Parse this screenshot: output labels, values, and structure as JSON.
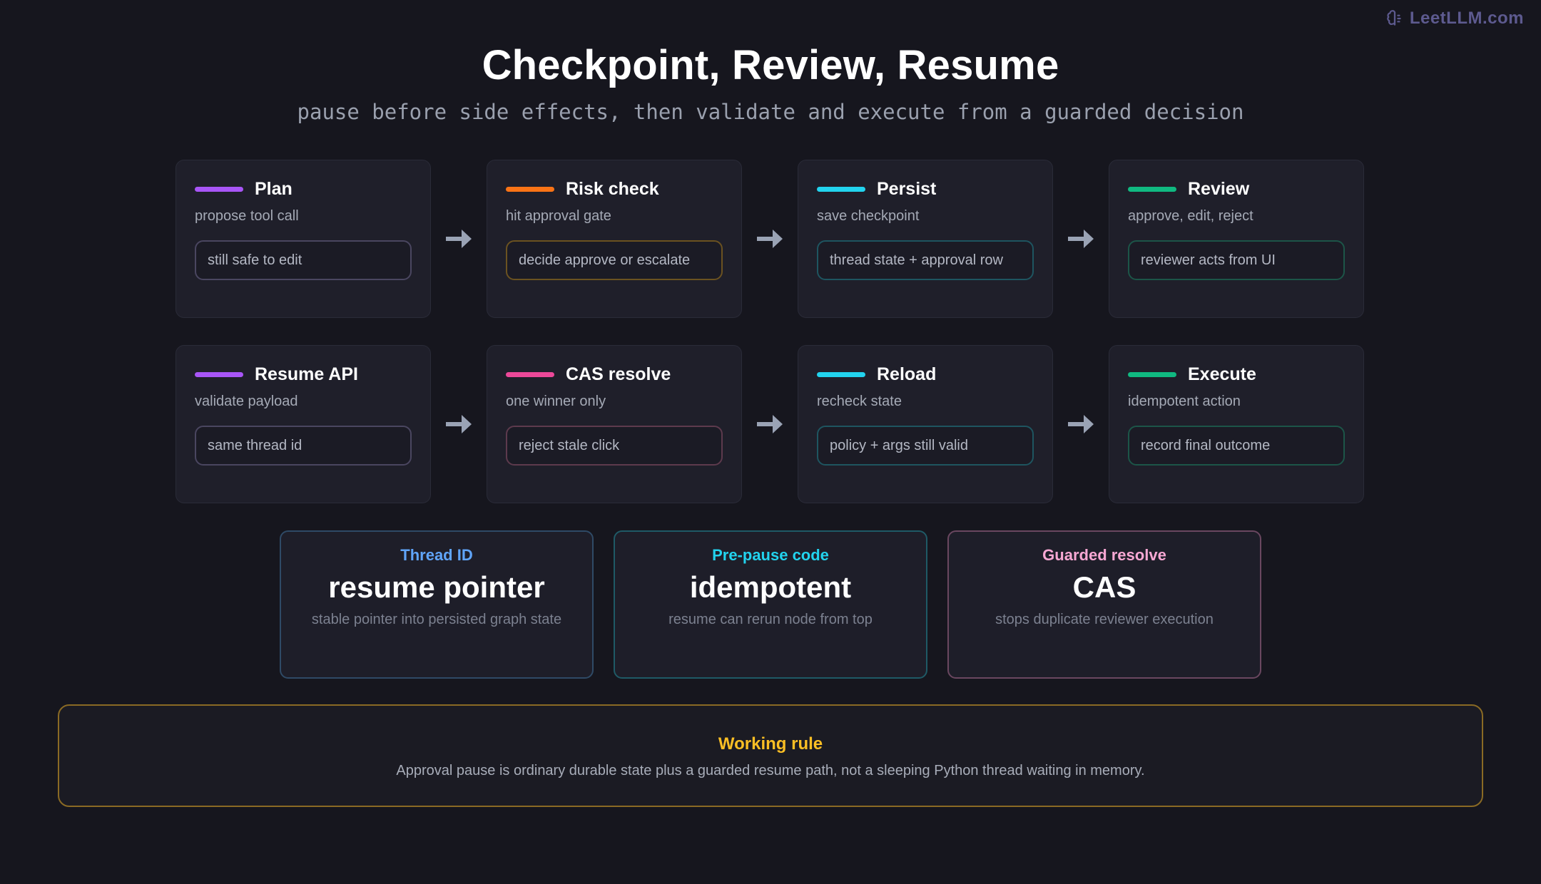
{
  "brand": {
    "icon": "brain-icon",
    "text": "LeetLLM.com",
    "color": "#5d5a8f"
  },
  "header": {
    "title": "Checkpoint, Review, Resume",
    "subtitle": "pause before side effects, then validate and execute from a guarded decision"
  },
  "rows": [
    {
      "cards": [
        {
          "title": "Plan",
          "subtitle": "propose tool call",
          "chip": "still safe to edit",
          "accent": "#a855f7",
          "chip_border": "#4a4660"
        },
        {
          "title": "Risk check",
          "subtitle": "hit approval gate",
          "chip": "decide approve or escalate",
          "accent": "#f97316",
          "chip_border": "#6b5220"
        },
        {
          "title": "Persist",
          "subtitle": "save checkpoint",
          "chip": "thread state + approval row",
          "accent": "#22d3ee",
          "chip_border": "#1e5560"
        },
        {
          "title": "Review",
          "subtitle": "approve, edit, reject",
          "chip": "reviewer acts from UI",
          "accent": "#10b981",
          "chip_border": "#1c5548"
        }
      ]
    },
    {
      "cards": [
        {
          "title": "Resume API",
          "subtitle": "validate payload",
          "chip": "same thread id",
          "accent": "#a855f7",
          "chip_border": "#4a4660"
        },
        {
          "title": "CAS resolve",
          "subtitle": "one winner only",
          "chip": "reject stale click",
          "accent": "#ec4899",
          "chip_border": "#5d3a4d"
        },
        {
          "title": "Reload",
          "subtitle": "recheck state",
          "chip": "policy + args still valid",
          "accent": "#22d3ee",
          "chip_border": "#1e5560"
        },
        {
          "title": "Execute",
          "subtitle": "idempotent action",
          "chip": "record final outcome",
          "accent": "#10b981",
          "chip_border": "#1c5548"
        }
      ]
    }
  ],
  "arrow_icon": "arrow-right-icon",
  "stats": [
    {
      "label": "Thread ID",
      "value": "resume pointer",
      "desc": "stable pointer into persisted graph state",
      "label_color": "#60a5fa",
      "border": "#2f4a66"
    },
    {
      "label": "Pre-pause code",
      "value": "idempotent",
      "desc": "resume can rerun node from top",
      "label_color": "#22d3ee",
      "border": "#1f5a66"
    },
    {
      "label": "Guarded resolve",
      "value": "CAS",
      "desc": "stops duplicate reviewer execution",
      "label_color": "#f9a8d4",
      "border": "#6a4760"
    }
  ],
  "rule": {
    "title": "Working rule",
    "text": "Approval pause is ordinary durable state plus a guarded resume path, not a sleeping Python thread waiting in memory."
  }
}
